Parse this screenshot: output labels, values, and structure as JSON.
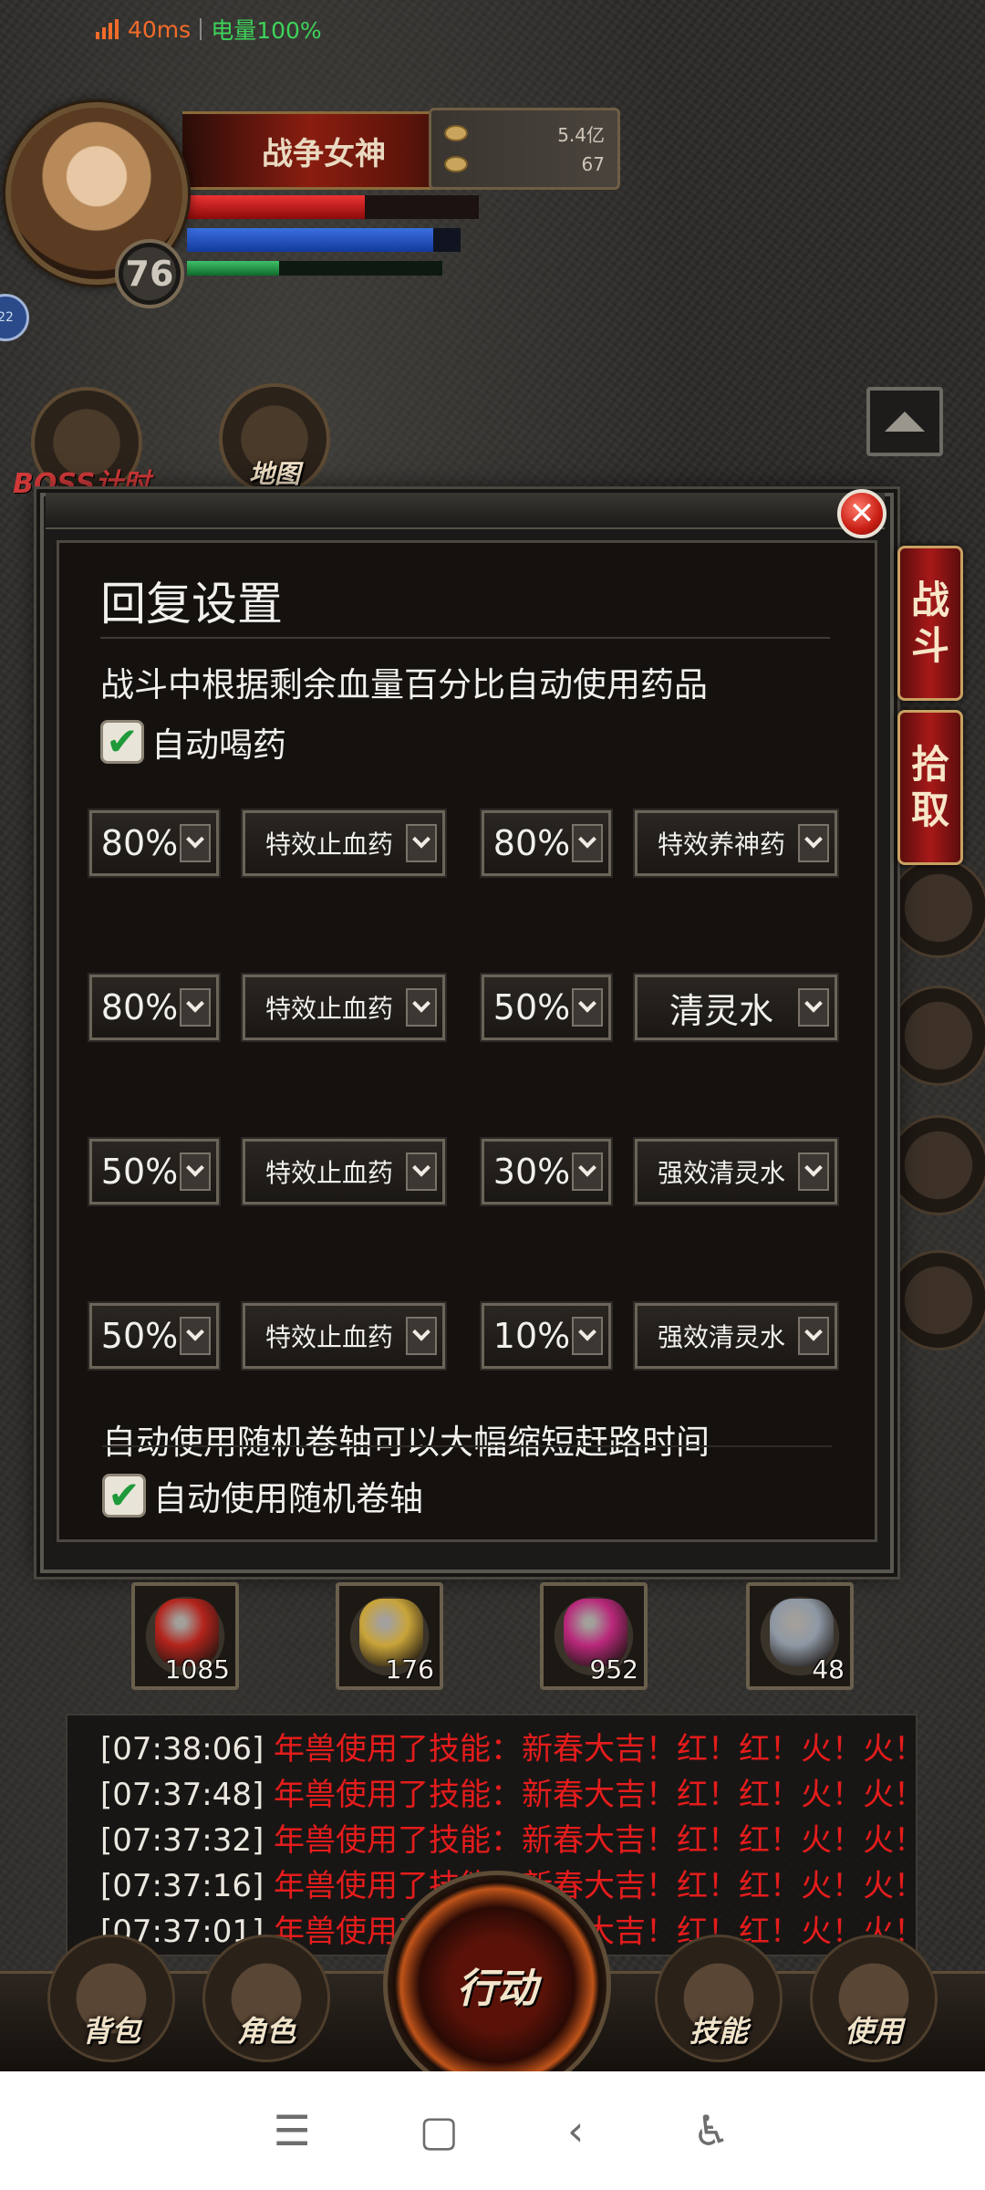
{
  "status_bar": {
    "ping": "40ms",
    "battery": "电量100%"
  },
  "player": {
    "name": "战争女神",
    "level": "76",
    "gold": "5.4亿",
    "ingot": "67",
    "hp_fraction": 0.61,
    "mp_fraction": 0.9,
    "xp_fraction": 0.36
  },
  "left_menu": {
    "boss_label": "BOSS计时",
    "map_label": "地图"
  },
  "right_tabs": {
    "fight": [
      "战",
      "斗"
    ],
    "pickup": [
      "拾",
      "取"
    ]
  },
  "dialog": {
    "title": "回复设置",
    "desc_potion": "战斗中根据剩余血量百分比自动使用药品",
    "auto_potion_label": "自动喝药",
    "rows": [
      {
        "hp_pct": "80%",
        "hp_item": "特效止血药",
        "mp_pct": "80%",
        "mp_item": "特效养神药"
      },
      {
        "hp_pct": "80%",
        "hp_item": "特效止血药",
        "mp_pct": "50%",
        "mp_item": "清灵水"
      },
      {
        "hp_pct": "50%",
        "hp_item": "特效止血药",
        "mp_pct": "30%",
        "mp_item": "强效清灵水"
      },
      {
        "hp_pct": "50%",
        "hp_item": "特效止血药",
        "mp_pct": "10%",
        "mp_item": "强效清灵水"
      }
    ],
    "desc_scroll": "自动使用随机卷轴可以大幅缩短赶路时间",
    "auto_scroll_label": "自动使用随机卷轴"
  },
  "quick_items": [
    {
      "count": "1085",
      "color": "#b2241c"
    },
    {
      "count": "176",
      "color": "#c9a43a"
    },
    {
      "count": "952",
      "color": "#b8287a"
    },
    {
      "count": "48",
      "color": "#8e98a4"
    }
  ],
  "log": [
    {
      "time": "[07:38:06]",
      "msg": "年兽使用了技能：新春大吉！红！红！火！火！"
    },
    {
      "time": "[07:37:48]",
      "msg": "年兽使用了技能：新春大吉！红！红！火！火！"
    },
    {
      "time": "[07:37:32]",
      "msg": "年兽使用了技能：新春大吉！红！红！火！火！"
    },
    {
      "time": "[07:37:16]",
      "msg": "年兽使用了技能：新春大吉！红！红！火！火！"
    },
    {
      "time": "[07:37:01]",
      "msg": "年兽使用了技能：新春大吉！红！红！火！火！"
    }
  ],
  "bottom_menu": {
    "bag": "背包",
    "role": "角色",
    "action": "行动",
    "skill": "技能",
    "use": "使用"
  },
  "navbar": {
    "menu_icon": "☰",
    "home_icon": "▢",
    "back_icon": "‹",
    "accessibility_icon": "♿"
  }
}
